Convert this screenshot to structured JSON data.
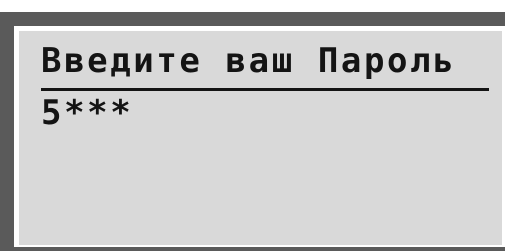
{
  "display": {
    "prompt": "Введите ваш Пароль",
    "password_value": "5***"
  },
  "colors": {
    "frame": "#5a5a5a",
    "screen_background": "#d9d9d9",
    "text": "#141414"
  }
}
